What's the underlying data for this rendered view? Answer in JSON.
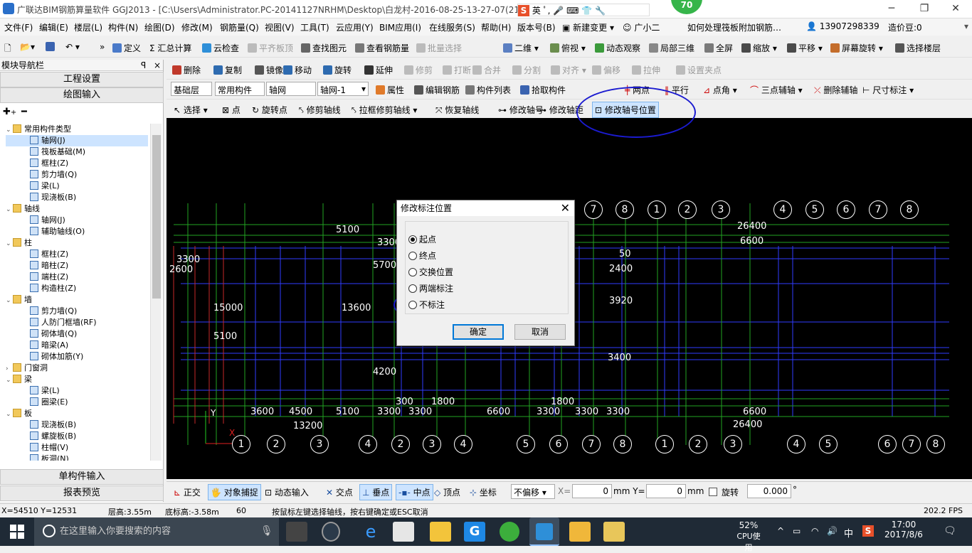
{
  "window": {
    "title": "广联达BIM钢筋算量软件 GGJ2013 - [C:\\Users\\Administrator.PC-20141127NRHM\\Desktop\\白龙村-2016-08-25-13-27-07(216",
    "badge": "70",
    "ime_label": "英"
  },
  "menubar": {
    "items": [
      "文件(F)",
      "编辑(E)",
      "楼层(L)",
      "构件(N)",
      "绘图(D)",
      "修改(M)",
      "钢筋量(Q)",
      "视图(V)",
      "工具(T)",
      "云应用(Y)",
      "BIM应用(I)",
      "在线服务(S)",
      "帮助(H)",
      "版本号(B)"
    ],
    "new_change": "新建变更",
    "guangxiaoer": "广小二",
    "help_link": "如何处理筏板附加钢筋…",
    "phone": "13907298339",
    "price_bean": "造价豆:0"
  },
  "toolbar1": {
    "items": [
      "定义",
      "汇总计算",
      "云检查",
      "平齐板顶",
      "查找图元",
      "查看钢筋量",
      "批量选择",
      "二维",
      "俯视",
      "动态观察",
      "局部三维",
      "全屏",
      "缩放",
      "平移",
      "屏幕旋转",
      "选择楼层"
    ]
  },
  "toolbar2": {
    "items": [
      "删除",
      "复制",
      "镜像",
      "移动",
      "旋转",
      "延伸",
      "修剪",
      "打断",
      "合并",
      "分割",
      "对齐",
      "偏移",
      "拉伸",
      "设置夹点"
    ]
  },
  "toolbar3": {
    "layer": "基础层",
    "category": "常用构件",
    "type": "轴网",
    "instance": "轴网-1",
    "items": [
      "属性",
      "编辑钢筋",
      "构件列表",
      "拾取构件",
      "两点",
      "平行",
      "点角",
      "三点辅轴",
      "删除辅轴",
      "尺寸标注"
    ]
  },
  "toolbar4": {
    "items": [
      "选择",
      "点",
      "旋转点",
      "修剪轴线",
      "拉框修剪轴线",
      "恢复轴线",
      "修改轴号",
      "修改轴距",
      "修改轴号位置"
    ]
  },
  "leftpanel": {
    "title": "模块导航栏",
    "project_settings": "工程设置",
    "drawing_input": "绘图输入",
    "single_input": "单构件输入",
    "report_preview": "报表预览",
    "tree": [
      {
        "level": 0,
        "label": "常用构件类型",
        "folder": true
      },
      {
        "level": 1,
        "label": "轴网(J)",
        "selected": true
      },
      {
        "level": 1,
        "label": "筏板基础(M)"
      },
      {
        "level": 1,
        "label": "框柱(Z)"
      },
      {
        "level": 1,
        "label": "剪力墙(Q)"
      },
      {
        "level": 1,
        "label": "梁(L)"
      },
      {
        "level": 1,
        "label": "现浇板(B)"
      },
      {
        "level": 0,
        "label": "轴线",
        "folder": true
      },
      {
        "level": 1,
        "label": "轴网(J)"
      },
      {
        "level": 1,
        "label": "辅助轴线(O)"
      },
      {
        "level": 0,
        "label": "柱",
        "folder": true
      },
      {
        "level": 1,
        "label": "框柱(Z)"
      },
      {
        "level": 1,
        "label": "暗柱(Z)"
      },
      {
        "level": 1,
        "label": "端柱(Z)"
      },
      {
        "level": 1,
        "label": "构造柱(Z)"
      },
      {
        "level": 0,
        "label": "墙",
        "folder": true
      },
      {
        "level": 1,
        "label": "剪力墙(Q)"
      },
      {
        "level": 1,
        "label": "人防门框墙(RF)"
      },
      {
        "level": 1,
        "label": "砌体墙(Q)"
      },
      {
        "level": 1,
        "label": "暗梁(A)"
      },
      {
        "level": 1,
        "label": "砌体加筋(Y)"
      },
      {
        "level": 0,
        "label": "门窗洞",
        "folder": true
      },
      {
        "level": 0,
        "label": "梁",
        "folder": true
      },
      {
        "level": 1,
        "label": "梁(L)"
      },
      {
        "level": 1,
        "label": "圈梁(E)"
      },
      {
        "level": 0,
        "label": "板",
        "folder": true
      },
      {
        "level": 1,
        "label": "现浇板(B)"
      },
      {
        "level": 1,
        "label": "螺旋板(B)"
      },
      {
        "level": 1,
        "label": "柱帽(V)"
      },
      {
        "level": 1,
        "label": "板洞(N)"
      }
    ]
  },
  "dialog": {
    "title": "修改标注位置",
    "options": [
      "起点",
      "终点",
      "交换位置",
      "两端标注",
      "不标注"
    ],
    "selected": 0,
    "ok": "确定",
    "cancel": "取消"
  },
  "canvas": {
    "top_axes_right": [
      "7",
      "8",
      "1",
      "2",
      "3",
      "4",
      "5",
      "6",
      "7",
      "8"
    ],
    "bottom_axes": [
      "1",
      "2",
      "3",
      "4",
      "2",
      "3",
      "4",
      "5",
      "6",
      "7",
      "8",
      "1",
      "2",
      "3",
      "4",
      "5",
      "6",
      "7",
      "8"
    ],
    "dims": [
      "5100",
      "3300",
      "26400",
      "6600",
      "2400",
      "3920",
      "13600",
      "3600",
      "4500",
      "5100",
      "3300",
      "3300",
      "6600",
      "3300",
      "3300",
      "3300",
      "26400",
      "13200",
      "1800",
      "300",
      "50",
      "1800",
      "2600",
      "3300",
      "15000",
      "5100",
      "4200",
      "3400",
      "5700",
      "6600"
    ],
    "ucs_y": "Y",
    "ucs_x": "X"
  },
  "bottombar": {
    "items": [
      "正交",
      "对象捕捉",
      "动态输入",
      "交点",
      "垂点",
      "中点",
      "顶点",
      "坐标"
    ],
    "offset_mode": "不偏移",
    "x_label": "X=",
    "x_value": "0",
    "y_label": "mm Y=",
    "y_value": "0",
    "unit": "mm",
    "rotate_label": "旋转",
    "rotate_value": "0.000",
    "degree": "°"
  },
  "statusbar": {
    "coords": "X=54510 Y=12531",
    "floor_height": "层高:3.55m",
    "bottom_height": "底标高:-3.58m",
    "num": "60",
    "hint": "按鼠标左键选择轴线，按右键确定或ESC取消",
    "fps": "202.2 FPS"
  },
  "taskbar": {
    "search_placeholder": "在这里输入你要搜索的内容",
    "cpu_percent": "52%",
    "cpu_label": "CPU使用",
    "ime": "中",
    "time": "17:00",
    "date": "2017/8/6"
  },
  "colors": {
    "canvas_bg": "#000000",
    "grid_blue": "#2f3cff",
    "grid_green": "#22a322",
    "annotation_ellipse": "#1b1bd0"
  }
}
